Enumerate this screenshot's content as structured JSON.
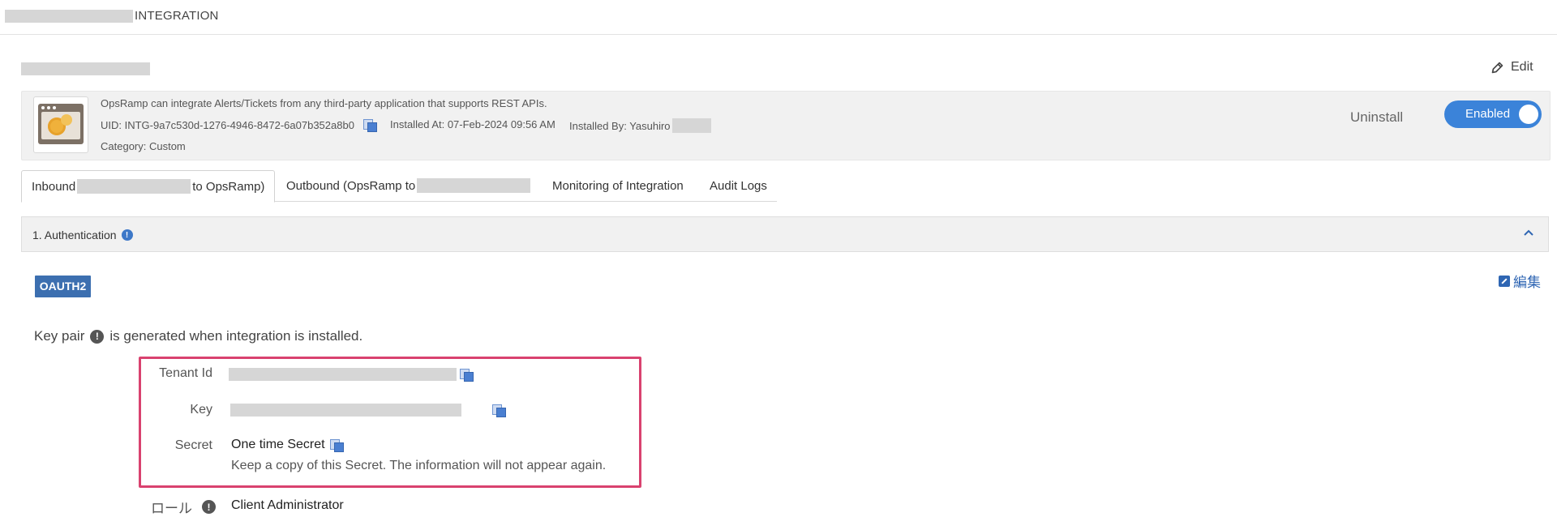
{
  "header": {
    "breadcrumb": "INTEGRATION"
  },
  "actions": {
    "edit_label": "Edit"
  },
  "summary": {
    "description": "OpsRamp can integrate Alerts/Tickets from any third-party application that supports REST APIs.",
    "uid": "UID: INTG-9a7c530d-1276-4946-8472-6a07b352a8b0",
    "installed_at": "Installed At: 07-Feb-2024 09:56 AM",
    "installed_by": "Installed By: Yasuhiro",
    "category": "Category: Custom",
    "uninstall_label": "Uninstall",
    "status_label": "Enabled"
  },
  "tabs": [
    {
      "label_prefix": "Inbound",
      "label_suffix": "to OpsRamp)"
    },
    {
      "label_prefix": "Outbound (OpsRamp to"
    },
    {
      "label": "Monitoring of Integration"
    },
    {
      "label": "Audit Logs"
    }
  ],
  "section": {
    "title": "1. Authentication",
    "auth_type": "OAUTH2",
    "edit_label": "編集",
    "keypair_prefix": "Key pair",
    "keypair_suffix": "is generated when integration is installed."
  },
  "fields": {
    "tenant_label": "Tenant Id",
    "key_label": "Key",
    "secret_label": "Secret",
    "secret_value": "One time Secret",
    "secret_note": "Keep a copy of this Secret. The information will not appear again.",
    "role_label": "ロール",
    "role_value": "Client Administrator"
  },
  "colors": {
    "accent": "#3b83d9",
    "highlight": "#d9426f",
    "badge": "#3c6fb0"
  }
}
